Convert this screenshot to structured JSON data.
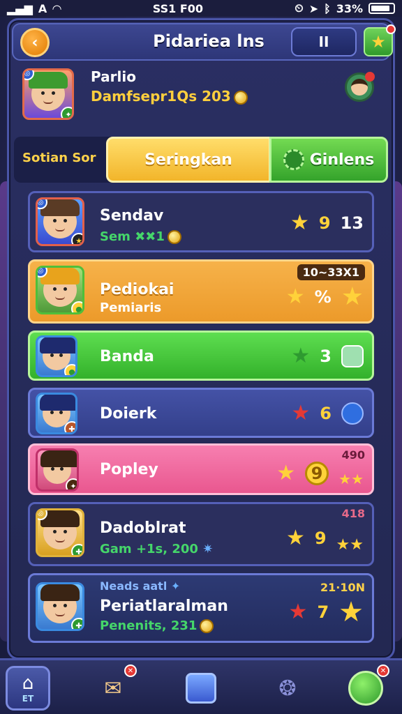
{
  "status_bar": {
    "time": "SS1 F00",
    "battery": "33%"
  },
  "header": {
    "title": "Pidariea lns",
    "pause_label": "II"
  },
  "profile": {
    "name": "Parlio",
    "subtitle": "Damfsepr1Qs 203"
  },
  "tabs": {
    "static_label": "Sotian Sor",
    "tab1": "Seringkan",
    "tab2": "Ginlens"
  },
  "list": [
    {
      "name": "Sendav",
      "sub": "Sem ✖✖1",
      "value": "9",
      "extra": "13",
      "tag": "",
      "bg": "#2b2f5e",
      "sub_color": "#45d66a"
    },
    {
      "name": "Pediokai",
      "sub": "Pemiaris",
      "value": "%",
      "extra": "",
      "tag": "10~33X1",
      "bg": "#f4a73a",
      "sub_color": "#fff"
    },
    {
      "name": "Banda",
      "sub": "",
      "value": "3",
      "extra": "",
      "tag": "",
      "bg": "#4fd14b",
      "sub_color": "#fff"
    },
    {
      "name": "Doierk",
      "sub": "",
      "value": "6",
      "extra": "",
      "tag": "",
      "bg": "#3d4a9a",
      "sub_color": "#fff"
    },
    {
      "name": "Popley",
      "sub": "",
      "value": "9",
      "extra": "",
      "tag": "490",
      "bg": "#f2679f",
      "sub_color": "#fff"
    },
    {
      "name": "Dadoblrat",
      "sub": "Gam +1s, 200",
      "value": "9",
      "extra": "",
      "tag": "418",
      "bg": "#2b2f5e",
      "sub_color": "#45d66a"
    },
    {
      "name": "Periatlaralman",
      "sub": "Penenits, 231",
      "value": "7",
      "extra": "",
      "tag": "21·10N",
      "top_label": "Neads aatl",
      "bg": "#2a3566",
      "sub_color": "#45d66a"
    }
  ],
  "bottom_nav": {
    "home_label": "ET"
  }
}
